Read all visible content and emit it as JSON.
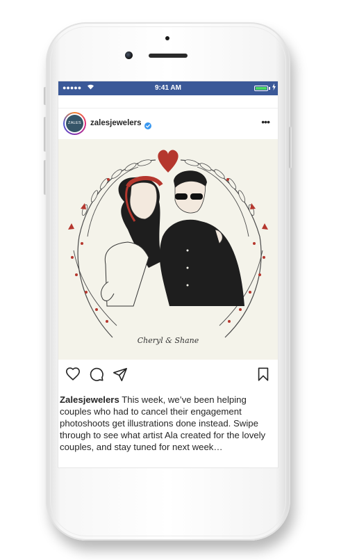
{
  "status_bar": {
    "signal": "●●●●●",
    "time": "9:41 AM",
    "battery_level": 1.0,
    "bar_color": "#3b5998"
  },
  "post": {
    "avatar_text": "ZALES",
    "username": "zalesjewelers",
    "verified": true,
    "more_icon": "more-horizontal-icon",
    "image": {
      "signature": "Cheryl & Shane",
      "background_color": "#f4f3ea",
      "accent_color": "#b5372e"
    },
    "actions": [
      "heart-icon",
      "comment-icon",
      "share-icon",
      "bookmark-icon"
    ],
    "caption": {
      "author": "Zalesjewelers",
      "text": "This week, we’ve been helping couples who had to cancel their engagement photoshoots get illustrations done instead. Swipe through to see what artist Ala created for the lovely couples, and stay tuned for next week…"
    }
  }
}
